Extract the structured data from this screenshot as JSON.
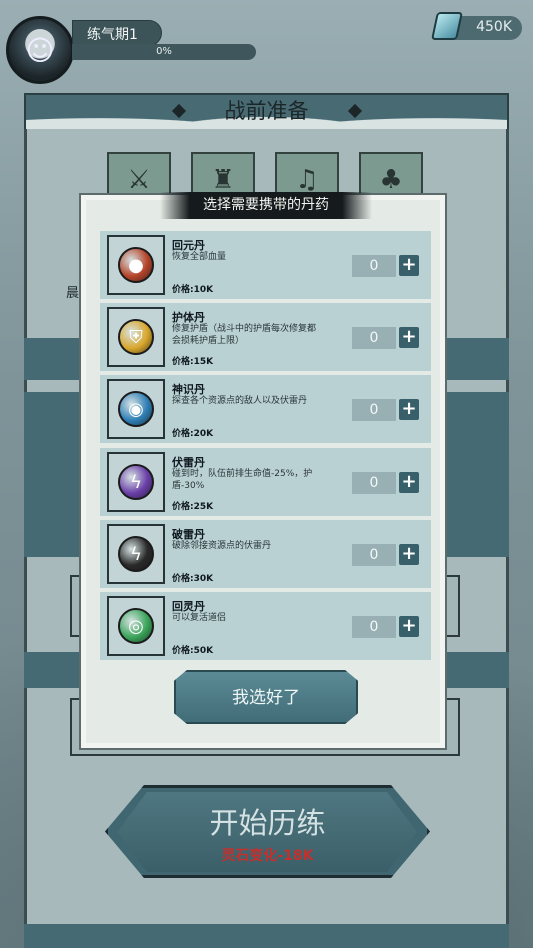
{
  "hud": {
    "realm": "练气期1",
    "progress_text": "0%",
    "currency": "450K"
  },
  "panel": {
    "title": "战前准备",
    "partial_label": "晨"
  },
  "overlay": {
    "title": "选择需要携带的丹药",
    "confirm_label": "我选好了",
    "items": [
      {
        "name": "回元丹",
        "desc": "恢复全部血量",
        "price": "价格:10K",
        "qty": "0",
        "color": "#b5452a",
        "icon": "red-orb-icon",
        "glyph": "●"
      },
      {
        "name": "护体丹",
        "desc": "修复护盾（战斗中的护盾每次修复都会损耗护盾上限）",
        "price": "价格:15K",
        "qty": "0",
        "color": "#d9a72c",
        "icon": "shield-pill-icon",
        "glyph": "⛨"
      },
      {
        "name": "神识丹",
        "desc": "探查各个资源点的敌人以及伏雷丹",
        "price": "价格:20K",
        "qty": "0",
        "color": "#2f7fb6",
        "icon": "eye-pill-icon",
        "glyph": "◉"
      },
      {
        "name": "伏雷丹",
        "desc": "碰到时，队伍前排生命值-25%，护盾-30%",
        "price": "价格:25K",
        "qty": "0",
        "color": "#6a3fa8",
        "icon": "lightning-crystal-icon",
        "glyph": "ϟ"
      },
      {
        "name": "破雷丹",
        "desc": "破除邻接资源点的伏雷丹",
        "price": "价格:30K",
        "qty": "0",
        "color": "#2a2a2a",
        "icon": "black-bolt-orb-icon",
        "glyph": "ϟ"
      },
      {
        "name": "回灵丹",
        "desc": "可以复活道侣",
        "price": "价格:50K",
        "qty": "0",
        "color": "#3aa55a",
        "icon": "green-swirl-orb-icon",
        "glyph": "◎"
      }
    ]
  },
  "start": {
    "label": "开始历练",
    "sub": "灵石变化-18K"
  }
}
